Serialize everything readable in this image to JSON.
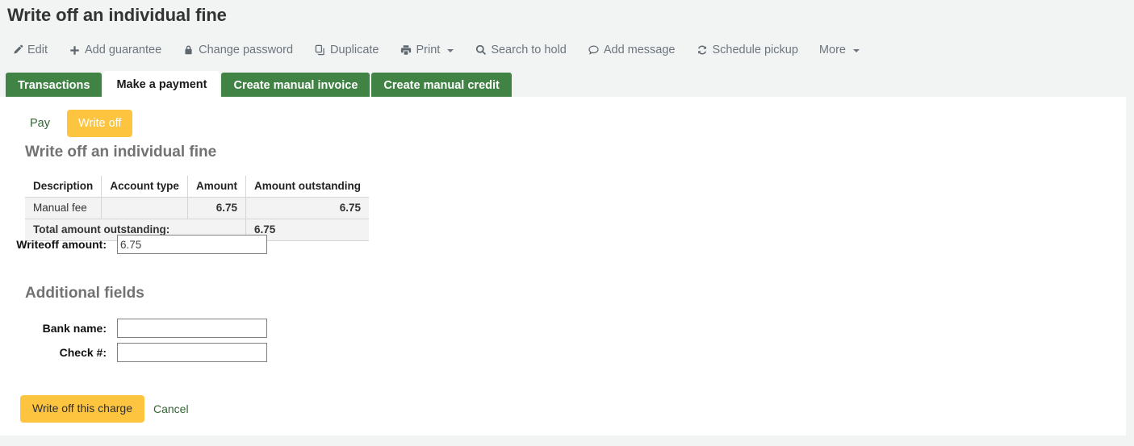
{
  "page": {
    "title": "Write off an individual fine"
  },
  "toolbar": {
    "items": [
      {
        "label": "Edit",
        "icon": "pencil-icon",
        "caret": false
      },
      {
        "label": "Add guarantee",
        "icon": "plus-icon",
        "caret": false
      },
      {
        "label": "Change password",
        "icon": "lock-icon",
        "caret": false
      },
      {
        "label": "Duplicate",
        "icon": "copy-icon",
        "caret": false
      },
      {
        "label": "Print",
        "icon": "printer-icon",
        "caret": true
      },
      {
        "label": "Search to hold",
        "icon": "search-icon",
        "caret": false
      },
      {
        "label": "Add message",
        "icon": "comment-icon",
        "caret": false
      },
      {
        "label": "Schedule pickup",
        "icon": "refresh-icon",
        "caret": false
      },
      {
        "label": "More",
        "icon": "none",
        "caret": true
      }
    ]
  },
  "tabs": [
    {
      "label": "Transactions",
      "active": false
    },
    {
      "label": "Make a payment",
      "active": true
    },
    {
      "label": "Create manual invoice",
      "active": false
    },
    {
      "label": "Create manual credit",
      "active": false
    }
  ],
  "subtabs": {
    "pay_label": "Pay",
    "writeoff_label": "Write off"
  },
  "content": {
    "heading": "Write off an individual fine",
    "additional_heading": "Additional fields"
  },
  "fines_table": {
    "headers": [
      "Description",
      "Account type",
      "Amount",
      "Amount outstanding"
    ],
    "rows": [
      {
        "description": "Manual fee",
        "account_type": "",
        "amount": "6.75",
        "amount_outstanding": "6.75"
      }
    ],
    "total_label": "Total amount outstanding:",
    "total_value": "6.75"
  },
  "form": {
    "writeoff_label": "Writeoff amount:",
    "writeoff_value": "6.75",
    "bank_label": "Bank name:",
    "bank_value": "",
    "check_label": "Check #:",
    "check_value": ""
  },
  "actions": {
    "submit_label": "Write off this charge",
    "cancel_label": "Cancel"
  },
  "colors": {
    "tab_green": "#418245",
    "accent_yellow": "#fdc53f",
    "link_green": "#336633",
    "amount_red": "#cc0000",
    "heading_gray": "#727272",
    "page_bg": "#f2f4f4"
  }
}
